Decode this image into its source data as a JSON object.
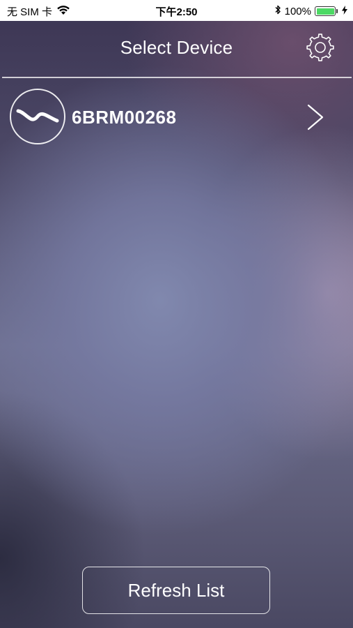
{
  "status_bar": {
    "carrier": "无 SIM 卡",
    "time": "下午2:50",
    "battery_percent": "100%",
    "battery_level": 1.0,
    "icons": [
      "wifi-icon",
      "bluetooth-icon",
      "battery-icon",
      "charging-bolt-icon"
    ]
  },
  "nav": {
    "title": "Select Device",
    "settings_icon": "gear-icon"
  },
  "devices": [
    {
      "name": "6BRM00268",
      "icon": "adjustable-bed-icon",
      "action_icon": "chevron-right-icon"
    }
  ],
  "footer": {
    "refresh_label": "Refresh List"
  },
  "colors": {
    "text": "#ffffff",
    "battery_fill": "#4cd964",
    "status_bar_bg": "#ffffff"
  }
}
